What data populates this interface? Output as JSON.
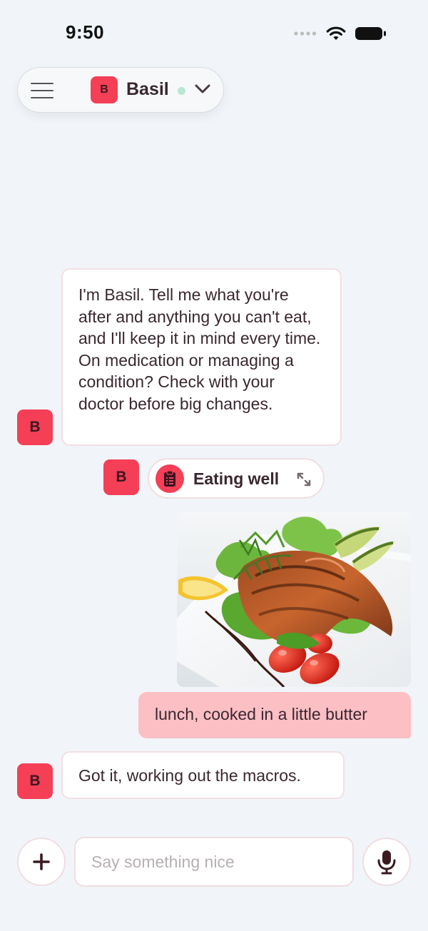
{
  "status_bar": {
    "time": "9:50"
  },
  "header": {
    "assistant_name": "Basil",
    "avatar_letter": "B",
    "online": true
  },
  "messages": [
    {
      "role": "assistant",
      "avatar_letter": "B",
      "text": "I'm Basil. Tell me what you're after and anything you can't eat, and I'll keep it in mind every time. On medication or managing a condition? Check with your doctor before big changes."
    },
    {
      "role": "assistant",
      "avatar_letter": "B",
      "type": "tool_chip",
      "label": "Eating well",
      "icon": "clipboard-icon"
    },
    {
      "role": "user",
      "type": "image",
      "image": "grilled-salmon-salad-photo"
    },
    {
      "role": "user",
      "text": "lunch, cooked in a little butter"
    },
    {
      "role": "assistant",
      "avatar_letter": "B",
      "text": "Got it, working out the macros."
    }
  ],
  "composer": {
    "placeholder": "Say something nice",
    "value": ""
  },
  "colors": {
    "background": "#f1f5f9",
    "accent": "#f43f56",
    "user_bubble": "#fbbfc4",
    "text": "#3a2730",
    "online_dot": "#b9e6d3"
  }
}
